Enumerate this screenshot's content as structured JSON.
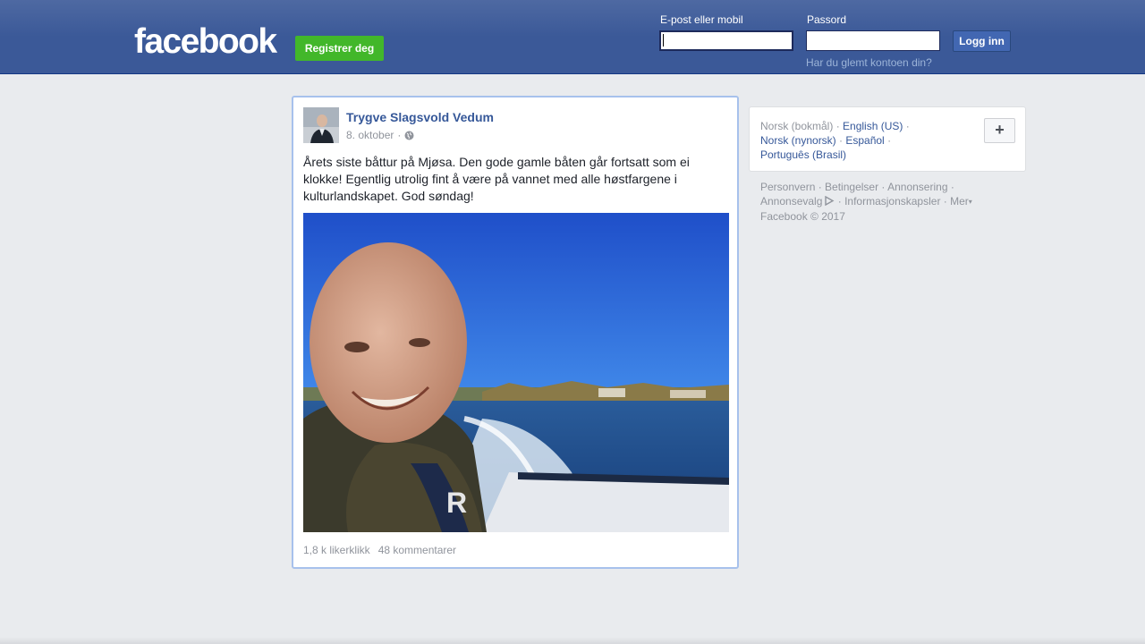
{
  "header": {
    "logo": "facebook",
    "register_label": "Registrer deg",
    "email_label": "E-post eller mobil",
    "email_value": "",
    "password_label": "Passord",
    "password_value": "",
    "login_label": "Logg inn",
    "forgot_label": "Har du glemt kontoen din?"
  },
  "post": {
    "author": "Trygve Slagsvold Vedum",
    "date": "8. oktober",
    "separator": "·",
    "privacy_icon": "globe-icon",
    "text": "Årets siste båttur på Mjøsa. Den gode gamle båten går fortsatt som ei klokke! Egentlig utrolig fint å være på vannet med alle høstfargene i kulturlandskapet. God søndag!",
    "likes": "1,8 k likerklikk",
    "comments": "48 kommentarer"
  },
  "languages": {
    "current": "Norsk (bokmål)",
    "options": [
      "English (US)",
      "Norsk (nynorsk)",
      "Español",
      "Português (Brasil)"
    ],
    "more_icon": "plus-icon"
  },
  "footer": {
    "privacy": "Personvern",
    "terms": "Betingelser",
    "advertising": "Annonsering",
    "ad_choices": "Annonsevalg",
    "cookies": "Informasjonskapsler",
    "more": "Mer",
    "copyright": "Facebook © 2017"
  },
  "colors": {
    "header_blue": "#3b5998",
    "link_blue": "#365899",
    "register_green": "#42b72a",
    "page_bg": "#e9ebee"
  }
}
